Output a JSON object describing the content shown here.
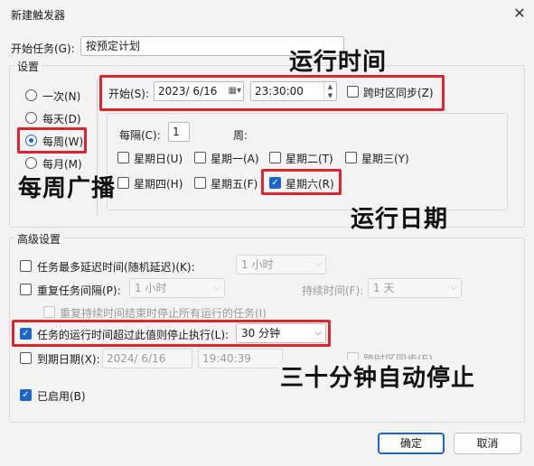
{
  "window": {
    "title": "新建触发器",
    "close": "✕"
  },
  "begin_task": {
    "label": "开始任务(G):",
    "value": "按预定计划"
  },
  "settings": {
    "label": "设置",
    "radios": [
      {
        "label": "一次(N)",
        "checked": false
      },
      {
        "label": "每天(D)",
        "checked": false
      },
      {
        "label": "每周(W)",
        "checked": true
      },
      {
        "label": "每月(M)",
        "checked": false
      }
    ],
    "start_label": "开始(S):",
    "start_date": "2023/  6/16",
    "start_time": "23:30:00",
    "sync_label": "跨时区同步(Z)",
    "every_label": "每隔(C):",
    "every_value": "1",
    "week_label": "周:",
    "days": [
      {
        "label": "星期日(U)",
        "checked": false
      },
      {
        "label": "星期一(A)",
        "checked": false
      },
      {
        "label": "星期二(T)",
        "checked": false
      },
      {
        "label": "星期三(Y)",
        "checked": false
      },
      {
        "label": "星期四(H)",
        "checked": false
      },
      {
        "label": "星期五(F)",
        "checked": false
      },
      {
        "label": "星期六(R)",
        "checked": true
      }
    ]
  },
  "advanced": {
    "label": "高级设置",
    "delay_label": "任务最多延迟时间(随机延迟)(K):",
    "delay_value": "1 小时",
    "repeat_label": "重复任务间隔(P):",
    "repeat_value": "1 小时",
    "duration_label": "持续时间(F):",
    "duration_value": "1 天",
    "stop_all_label": "重复持续时间结束时停止所有运行的任务(I)",
    "stop_if_label": "任务的运行时间超过此值则停止执行(L):",
    "stop_if_value": "30 分钟",
    "expire_label": "到期日期(X):",
    "expire_date": "2024/  6/16",
    "expire_time": "19:40:39",
    "expire_sync_label": "跨时区同步(E)",
    "enabled_label": "已启用(B)"
  },
  "buttons": {
    "ok": "确定",
    "cancel": "取消"
  },
  "annotations": {
    "run_time": "运行时间",
    "weekly": "每周广播",
    "run_date": "运行日期",
    "auto_stop": "三十分钟自动停止"
  },
  "colors": {
    "highlight": "#e0242f",
    "accent": "#1a66cc"
  }
}
